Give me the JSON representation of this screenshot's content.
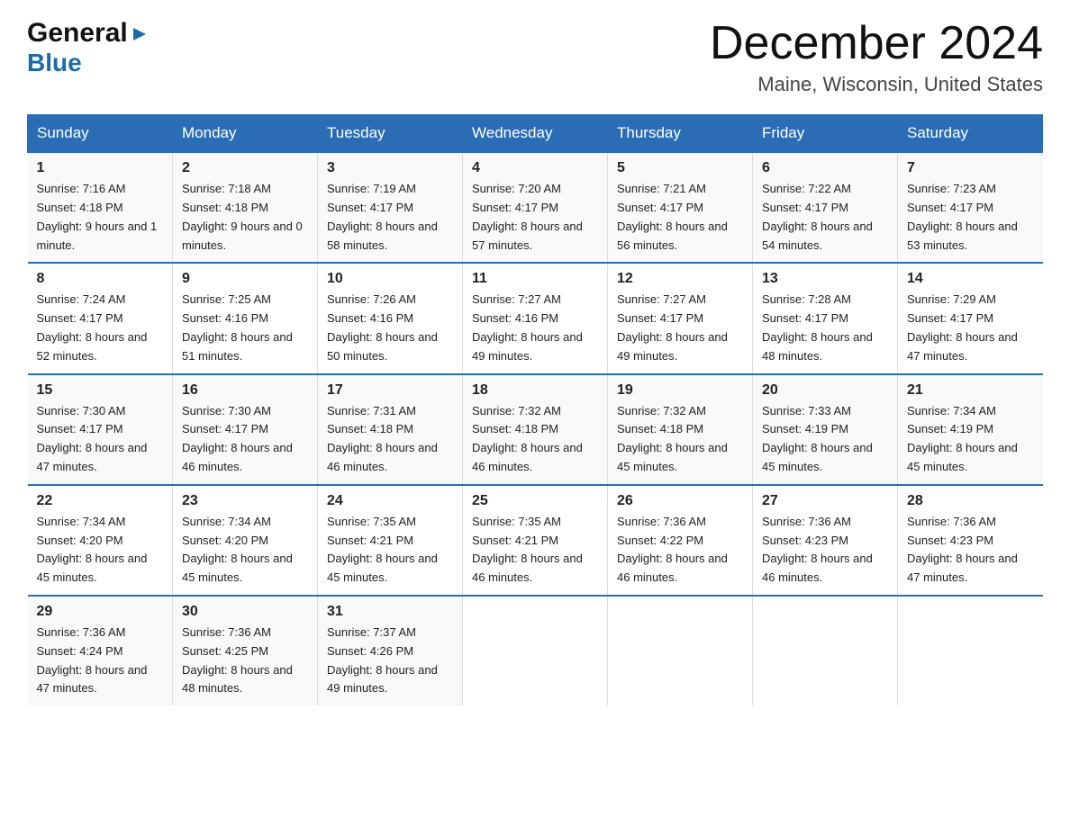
{
  "logo": {
    "line1": "General",
    "triangle": "▶",
    "line2": "Blue"
  },
  "title": {
    "month": "December 2024",
    "location": "Maine, Wisconsin, United States"
  },
  "headers": [
    "Sunday",
    "Monday",
    "Tuesday",
    "Wednesday",
    "Thursday",
    "Friday",
    "Saturday"
  ],
  "weeks": [
    [
      {
        "day": "1",
        "sunrise": "Sunrise: 7:16 AM",
        "sunset": "Sunset: 4:18 PM",
        "daylight": "Daylight: 9 hours and 1 minute."
      },
      {
        "day": "2",
        "sunrise": "Sunrise: 7:18 AM",
        "sunset": "Sunset: 4:18 PM",
        "daylight": "Daylight: 9 hours and 0 minutes."
      },
      {
        "day": "3",
        "sunrise": "Sunrise: 7:19 AM",
        "sunset": "Sunset: 4:17 PM",
        "daylight": "Daylight: 8 hours and 58 minutes."
      },
      {
        "day": "4",
        "sunrise": "Sunrise: 7:20 AM",
        "sunset": "Sunset: 4:17 PM",
        "daylight": "Daylight: 8 hours and 57 minutes."
      },
      {
        "day": "5",
        "sunrise": "Sunrise: 7:21 AM",
        "sunset": "Sunset: 4:17 PM",
        "daylight": "Daylight: 8 hours and 56 minutes."
      },
      {
        "day": "6",
        "sunrise": "Sunrise: 7:22 AM",
        "sunset": "Sunset: 4:17 PM",
        "daylight": "Daylight: 8 hours and 54 minutes."
      },
      {
        "day": "7",
        "sunrise": "Sunrise: 7:23 AM",
        "sunset": "Sunset: 4:17 PM",
        "daylight": "Daylight: 8 hours and 53 minutes."
      }
    ],
    [
      {
        "day": "8",
        "sunrise": "Sunrise: 7:24 AM",
        "sunset": "Sunset: 4:17 PM",
        "daylight": "Daylight: 8 hours and 52 minutes."
      },
      {
        "day": "9",
        "sunrise": "Sunrise: 7:25 AM",
        "sunset": "Sunset: 4:16 PM",
        "daylight": "Daylight: 8 hours and 51 minutes."
      },
      {
        "day": "10",
        "sunrise": "Sunrise: 7:26 AM",
        "sunset": "Sunset: 4:16 PM",
        "daylight": "Daylight: 8 hours and 50 minutes."
      },
      {
        "day": "11",
        "sunrise": "Sunrise: 7:27 AM",
        "sunset": "Sunset: 4:16 PM",
        "daylight": "Daylight: 8 hours and 49 minutes."
      },
      {
        "day": "12",
        "sunrise": "Sunrise: 7:27 AM",
        "sunset": "Sunset: 4:17 PM",
        "daylight": "Daylight: 8 hours and 49 minutes."
      },
      {
        "day": "13",
        "sunrise": "Sunrise: 7:28 AM",
        "sunset": "Sunset: 4:17 PM",
        "daylight": "Daylight: 8 hours and 48 minutes."
      },
      {
        "day": "14",
        "sunrise": "Sunrise: 7:29 AM",
        "sunset": "Sunset: 4:17 PM",
        "daylight": "Daylight: 8 hours and 47 minutes."
      }
    ],
    [
      {
        "day": "15",
        "sunrise": "Sunrise: 7:30 AM",
        "sunset": "Sunset: 4:17 PM",
        "daylight": "Daylight: 8 hours and 47 minutes."
      },
      {
        "day": "16",
        "sunrise": "Sunrise: 7:30 AM",
        "sunset": "Sunset: 4:17 PM",
        "daylight": "Daylight: 8 hours and 46 minutes."
      },
      {
        "day": "17",
        "sunrise": "Sunrise: 7:31 AM",
        "sunset": "Sunset: 4:18 PM",
        "daylight": "Daylight: 8 hours and 46 minutes."
      },
      {
        "day": "18",
        "sunrise": "Sunrise: 7:32 AM",
        "sunset": "Sunset: 4:18 PM",
        "daylight": "Daylight: 8 hours and 46 minutes."
      },
      {
        "day": "19",
        "sunrise": "Sunrise: 7:32 AM",
        "sunset": "Sunset: 4:18 PM",
        "daylight": "Daylight: 8 hours and 45 minutes."
      },
      {
        "day": "20",
        "sunrise": "Sunrise: 7:33 AM",
        "sunset": "Sunset: 4:19 PM",
        "daylight": "Daylight: 8 hours and 45 minutes."
      },
      {
        "day": "21",
        "sunrise": "Sunrise: 7:34 AM",
        "sunset": "Sunset: 4:19 PM",
        "daylight": "Daylight: 8 hours and 45 minutes."
      }
    ],
    [
      {
        "day": "22",
        "sunrise": "Sunrise: 7:34 AM",
        "sunset": "Sunset: 4:20 PM",
        "daylight": "Daylight: 8 hours and 45 minutes."
      },
      {
        "day": "23",
        "sunrise": "Sunrise: 7:34 AM",
        "sunset": "Sunset: 4:20 PM",
        "daylight": "Daylight: 8 hours and 45 minutes."
      },
      {
        "day": "24",
        "sunrise": "Sunrise: 7:35 AM",
        "sunset": "Sunset: 4:21 PM",
        "daylight": "Daylight: 8 hours and 45 minutes."
      },
      {
        "day": "25",
        "sunrise": "Sunrise: 7:35 AM",
        "sunset": "Sunset: 4:21 PM",
        "daylight": "Daylight: 8 hours and 46 minutes."
      },
      {
        "day": "26",
        "sunrise": "Sunrise: 7:36 AM",
        "sunset": "Sunset: 4:22 PM",
        "daylight": "Daylight: 8 hours and 46 minutes."
      },
      {
        "day": "27",
        "sunrise": "Sunrise: 7:36 AM",
        "sunset": "Sunset: 4:23 PM",
        "daylight": "Daylight: 8 hours and 46 minutes."
      },
      {
        "day": "28",
        "sunrise": "Sunrise: 7:36 AM",
        "sunset": "Sunset: 4:23 PM",
        "daylight": "Daylight: 8 hours and 47 minutes."
      }
    ],
    [
      {
        "day": "29",
        "sunrise": "Sunrise: 7:36 AM",
        "sunset": "Sunset: 4:24 PM",
        "daylight": "Daylight: 8 hours and 47 minutes."
      },
      {
        "day": "30",
        "sunrise": "Sunrise: 7:36 AM",
        "sunset": "Sunset: 4:25 PM",
        "daylight": "Daylight: 8 hours and 48 minutes."
      },
      {
        "day": "31",
        "sunrise": "Sunrise: 7:37 AM",
        "sunset": "Sunset: 4:26 PM",
        "daylight": "Daylight: 8 hours and 49 minutes."
      },
      null,
      null,
      null,
      null
    ]
  ]
}
